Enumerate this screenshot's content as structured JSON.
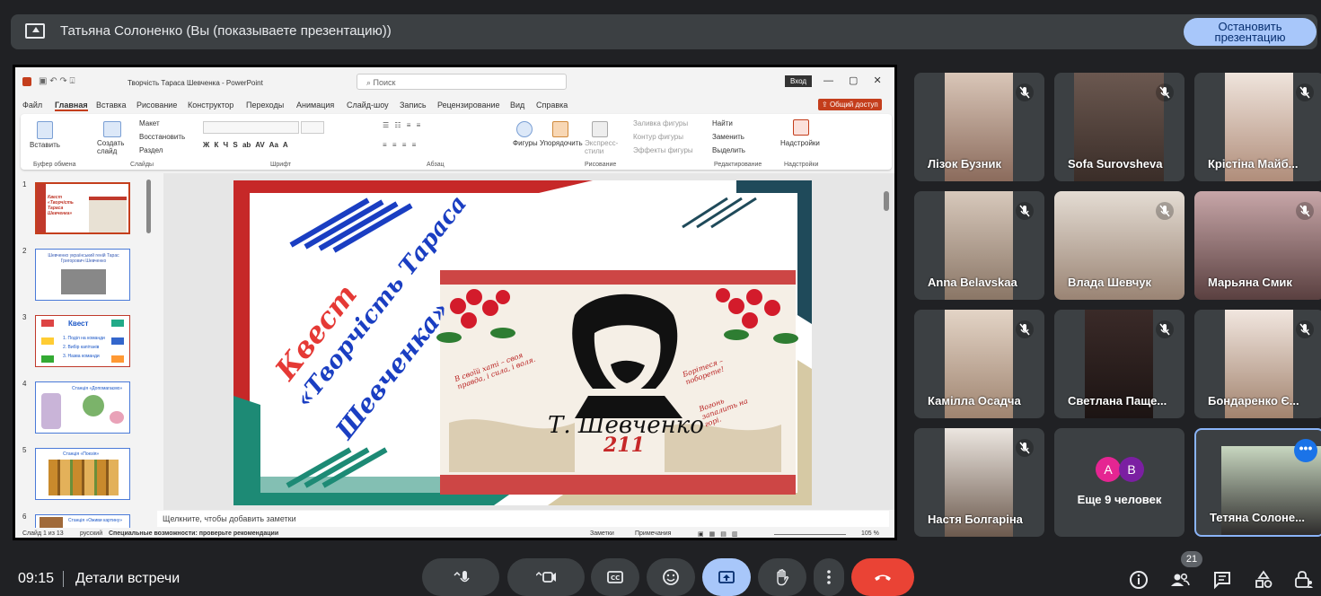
{
  "header": {
    "presenter_text": "Татьяна Солоненко (Вы (показываете презентацию))",
    "stop_button_label": "Остановить презентацию"
  },
  "ppt": {
    "doc_title": "Творчість Тараса Шевченка - PowerPoint",
    "search_placeholder": "Поиск",
    "login": "Вход",
    "share": "Общий доступ",
    "menu": [
      "Файл",
      "Главная",
      "Вставка",
      "Рисование",
      "Конструктор",
      "Переходы",
      "Анимация",
      "Слайд-шоу",
      "Запись",
      "Рецензирование",
      "Вид",
      "Справка"
    ],
    "ribbon": {
      "paste": "Вставить",
      "clipboard": "Буфер обмена",
      "new_slide": "Создать слайд",
      "layout": "Макет",
      "reset": "Восстановить",
      "section": "Раздел",
      "slides": "Слайды",
      "font": "Шрифт",
      "paragraph": "Абзац",
      "shapes": "Фигуры",
      "arrange": "Упорядочить",
      "quick_styles": "Экспресс-стили",
      "shape_fill": "Заливка фигуры",
      "shape_outline": "Контур фигуры",
      "shape_effects": "Эффекты фигуры",
      "drawing": "Рисование",
      "find": "Найти",
      "replace": "Заменить",
      "select": "Выделить",
      "editing": "Редактирование",
      "addins_btn": "Надстройки",
      "addins": "Надстройки"
    },
    "thumbs": [
      {
        "num": "1",
        "text": "Квест «Творчість Тараса Шевченка»"
      },
      {
        "num": "2",
        "text": "Шевченко український геній Тарас Григорович Шевченко"
      },
      {
        "num": "3",
        "title": "Квест",
        "lines": [
          "1. Поділ на команди",
          "2. Вибір капітанів",
          "3. Назва команди"
        ]
      },
      {
        "num": "4",
        "text": "Станція «Допомагаємо»"
      },
      {
        "num": "5",
        "text": "Станція «Поезія»"
      },
      {
        "num": "6",
        "text": "Станція «Оживи картину»"
      }
    ],
    "slide": {
      "kvest": "Квест",
      "line1": "«Творчість Тараса",
      "line2": "Шевченка»",
      "signature": "Т. Шевченко",
      "number": "211",
      "quote1": "В своїй хаті – своя правда, і сила, і воля.",
      "quote2": "Борітеся – поборете!",
      "quote3": "Вогонь запалить на горі."
    },
    "notes": "Щелкните, чтобы добавить заметки",
    "status": {
      "slide": "Слайд 1 из 13",
      "lang": "русский",
      "accessibility": "Специальные возможности: проверьте рекомендации",
      "notes_btn": "Заметки",
      "comments_btn": "Примечания",
      "zoom": "105 %"
    }
  },
  "participants": [
    {
      "name": "Лізок Бузник"
    },
    {
      "name": "Sofa Surovsheva"
    },
    {
      "name": "Крістіна Майб..."
    },
    {
      "name": "Anna Belavskaa"
    },
    {
      "name": "Влада Шевчук"
    },
    {
      "name": "Марьяна Смик"
    },
    {
      "name": "Камілла Осадча"
    },
    {
      "name": "Светлана Паще..."
    },
    {
      "name": "Бондаренко Є..."
    },
    {
      "name": "Настя Болгаріна"
    },
    {
      "name": "Еще 9 человек",
      "avatars": [
        "A",
        "B"
      ]
    },
    {
      "name": "Тетяна Солоне..."
    }
  ],
  "bottom": {
    "time": "09:15",
    "details": "Детали встречи",
    "people_count": "21"
  }
}
